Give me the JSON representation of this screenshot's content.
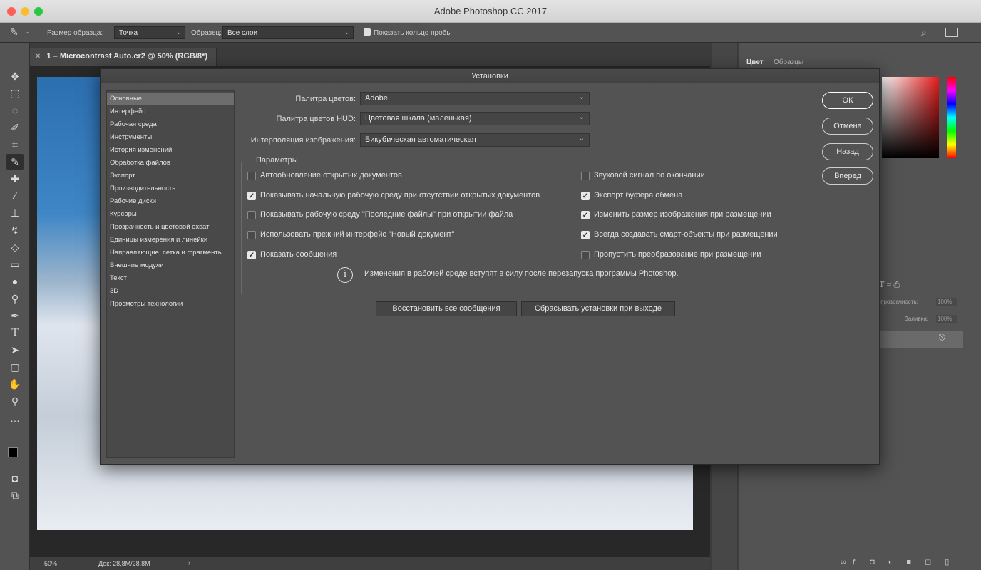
{
  "window": {
    "title": "Adobe Photoshop CC 2017"
  },
  "options_bar": {
    "sample_size_label": "Размер образца:",
    "sample_size_value": "Точка",
    "sample_label": "Образец:",
    "sample_value": "Все слои",
    "show_ring_label": "Показать кольцо пробы"
  },
  "document": {
    "tab_title": "1 – Microcontrast Auto.cr2 @ 50% (RGB/8*)",
    "zoom": "50%",
    "doc_size": "Док: 28,8M/28,8M"
  },
  "right_panel": {
    "tabs": [
      "Цвет",
      "Образцы"
    ],
    "opacity_label": "Непрозрачность:",
    "opacity_value": "100%",
    "fill_label": "Заливка:",
    "fill_value": "100%"
  },
  "dialog": {
    "title": "Установки",
    "nav": [
      "Основные",
      "Интерфейс",
      "Рабочая среда",
      "Инструменты",
      "История изменений",
      "Обработка файлов",
      "Экспорт",
      "Производительность",
      "Рабочие диски",
      "Курсоры",
      "Прозрачность и цветовой охват",
      "Единицы измерения и линейки",
      "Направляющие, сетка и фрагменты",
      "Внешние модули",
      "Текст",
      "3D",
      "Просмотры технологии"
    ],
    "color_picker_label": "Палитра цветов:",
    "color_picker_value": "Adobe",
    "hud_picker_label": "Палитра цветов HUD:",
    "hud_picker_value": "Цветовая шкала (маленькая)",
    "interpolation_label": "Интерполяция изображения:",
    "interpolation_value": "Бикубическая автоматическая",
    "params_title": "Параметры",
    "options_left": [
      {
        "label": "Автообновление открытых документов",
        "checked": false
      },
      {
        "label": "Показывать начальную рабочую среду при отсутствии открытых документов",
        "checked": true
      },
      {
        "label": "Показывать рабочую среду \"Последние файлы\" при открытии файла",
        "checked": false
      },
      {
        "label": "Использовать прежний интерфейс \"Новый документ\"",
        "checked": false
      },
      {
        "label": "Показать сообщения",
        "checked": true
      }
    ],
    "options_right": [
      {
        "label": "Звуковой сигнал по окончании",
        "checked": false
      },
      {
        "label": "Экспорт буфера обмена",
        "checked": true
      },
      {
        "label": "Изменить размер изображения при размещении",
        "checked": true
      },
      {
        "label": "Всегда создавать смарт-объекты при размещении",
        "checked": true
      },
      {
        "label": "Пропустить преобразование при размещении",
        "checked": false
      }
    ],
    "info_text": "Изменения в рабочей среде вступят в силу после перезапуска программы Photoshop.",
    "restore_button": "Восстановить все сообщения",
    "reset_button": "Сбрасывать установки при выходе",
    "ok_button": "ОК",
    "cancel_button": "Отмена",
    "back_button": "Назад",
    "forward_button": "Вперед"
  }
}
